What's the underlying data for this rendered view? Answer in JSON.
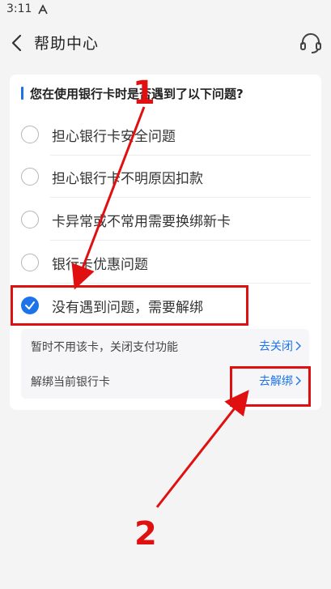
{
  "status_bar": {
    "time": "3:11",
    "icon": "notification-icon"
  },
  "header": {
    "title": "帮助中心",
    "back_icon": "back-arrow-icon",
    "service_icon": "customer-service-icon"
  },
  "question": "您在使用银行卡时是否遇到了以下问题?",
  "options": [
    {
      "label": "担心银行卡安全问题",
      "checked": false
    },
    {
      "label": "担心银行卡不明原因扣款",
      "checked": false
    },
    {
      "label": "卡异常或不常用需要换绑新卡",
      "checked": false
    },
    {
      "label": "银行卡优惠问题",
      "checked": false
    },
    {
      "label": "没有遇到问题，需要解绑",
      "checked": true
    }
  ],
  "sub_actions": [
    {
      "label": "暂时不用该卡，关闭支付功能",
      "link": "去关闭"
    },
    {
      "label": "解绑当前银行卡",
      "link": "去解绑"
    }
  ],
  "annotations": {
    "step1": "1",
    "step2": "2",
    "color": "#e01010"
  },
  "colors": {
    "accent": "#1d74e8"
  }
}
